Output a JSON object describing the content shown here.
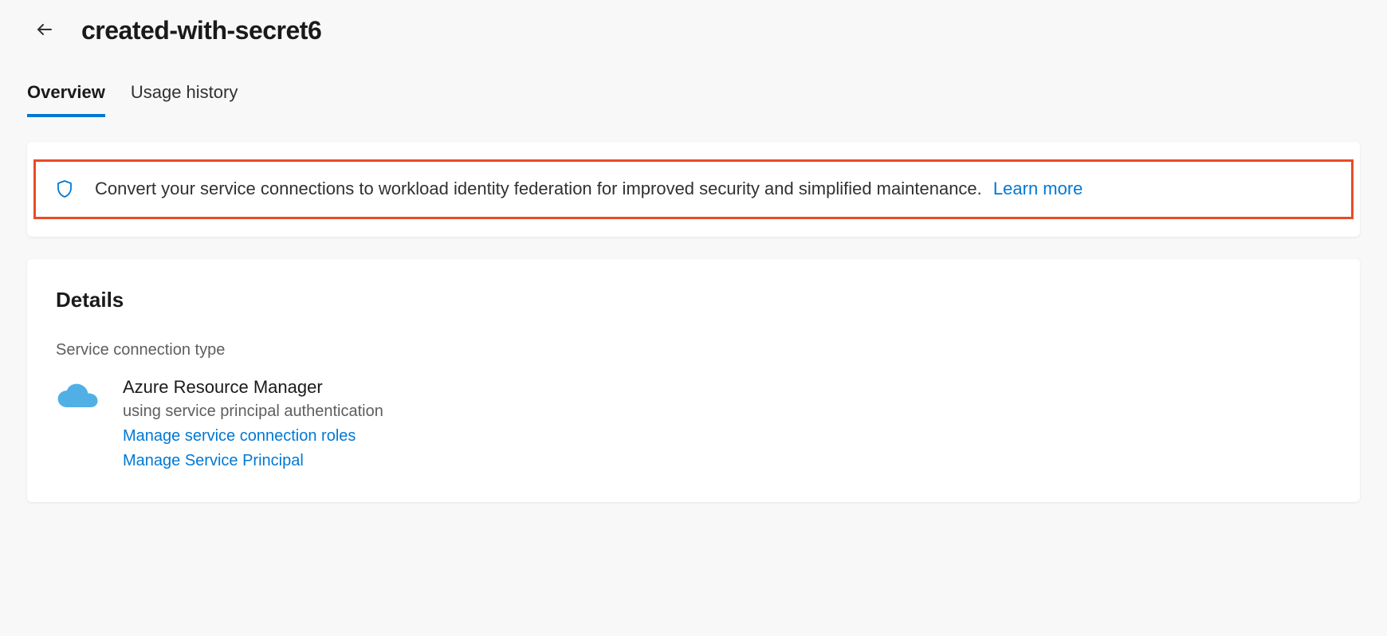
{
  "header": {
    "title": "created-with-secret6"
  },
  "tabs": [
    {
      "label": "Overview",
      "active": true
    },
    {
      "label": "Usage history",
      "active": false
    }
  ],
  "banner": {
    "text": "Convert your service connections to workload identity federation for improved security and simplified maintenance.",
    "learn_more_label": "Learn more"
  },
  "details": {
    "heading": "Details",
    "section_label": "Service connection type",
    "connection": {
      "name": "Azure Resource Manager",
      "subtext": "using service principal authentication",
      "links": [
        "Manage service connection roles",
        "Manage Service Principal"
      ]
    }
  },
  "icons": {
    "back": "back-arrow-icon",
    "shield": "shield-icon",
    "cloud": "cloud-icon"
  }
}
